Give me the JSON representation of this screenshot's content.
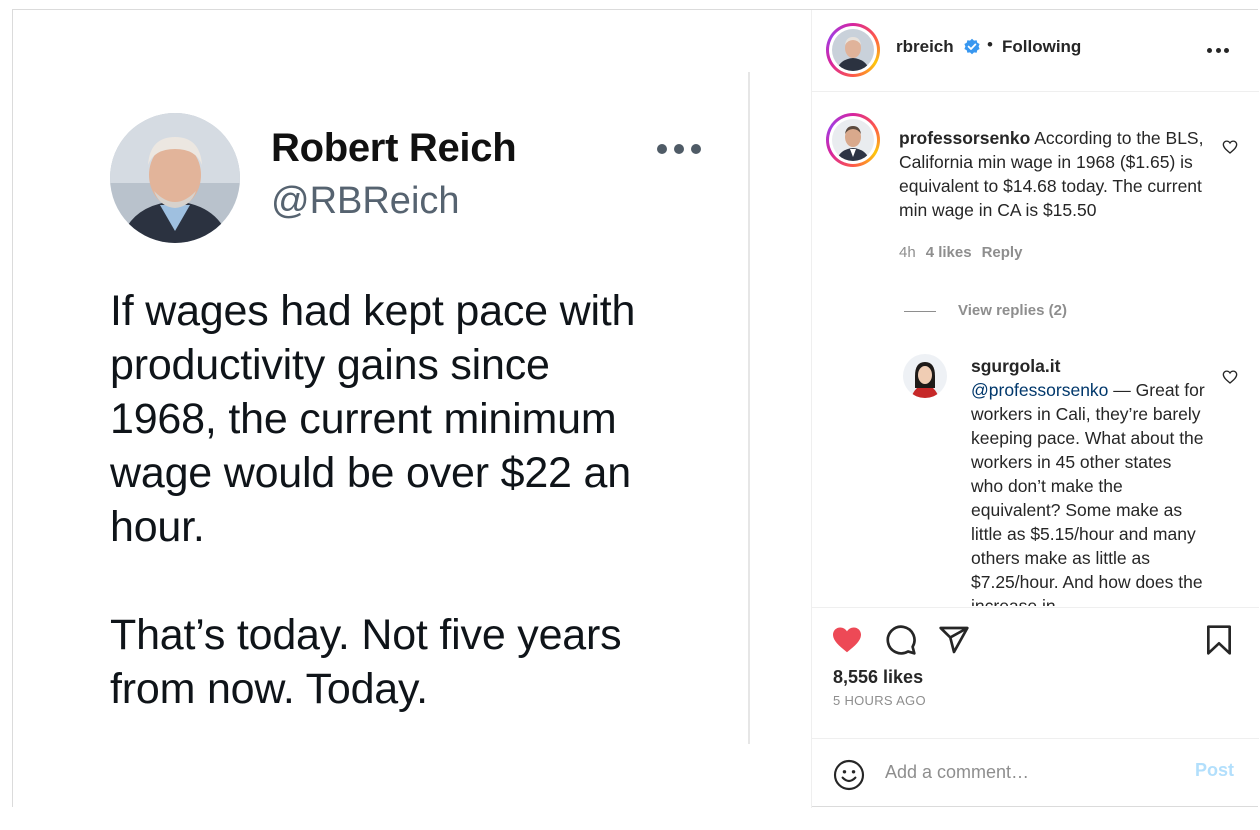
{
  "tweet": {
    "name": "Robert Reich",
    "handle": "@RBReich",
    "text_1": "If wages had kept pace with\nproductivity gains since\n1968, the current minimum\nwage would be over $22 an\nhour.",
    "text_2": "That’s today. Not five years\nfrom now. Today."
  },
  "header": {
    "username": "rbreich",
    "separator": "•",
    "follow_status": "Following"
  },
  "comments": [
    {
      "username": "professorsenko",
      "text": " According to the BLS, California min wage in 1968 ($1.65) is equivalent to $14.68 today. The current min wage in CA is $15.50",
      "time": "4h",
      "likes": "4 likes",
      "reply_label": "Reply",
      "view_replies": "View replies (2)"
    }
  ],
  "reply": {
    "username": "sgurgola.it",
    "mention": "@professorsenko",
    "text": " — Great for workers in Cali, they’re barely keeping pace. What about the workers in 45 other states who don’t make the equivalent? Some make as little as $5.15/hour and many others make as little as $7.25/hour. And how does the increase in"
  },
  "actions": {
    "likes": "8,556 likes",
    "time_ago": "5 HOURS AGO"
  },
  "add_comment": {
    "placeholder": "Add a comment…",
    "post_label": "Post"
  },
  "colors": {
    "like_red": "#ed4956",
    "verified_blue": "#3897f0",
    "post_disabled": "#b2dffc",
    "mention_blue": "#00376b"
  },
  "icons": [
    "more-horizontal-icon",
    "verified-badge-icon",
    "heart-icon",
    "comment-icon",
    "share-icon",
    "bookmark-icon",
    "smiley-icon"
  ]
}
